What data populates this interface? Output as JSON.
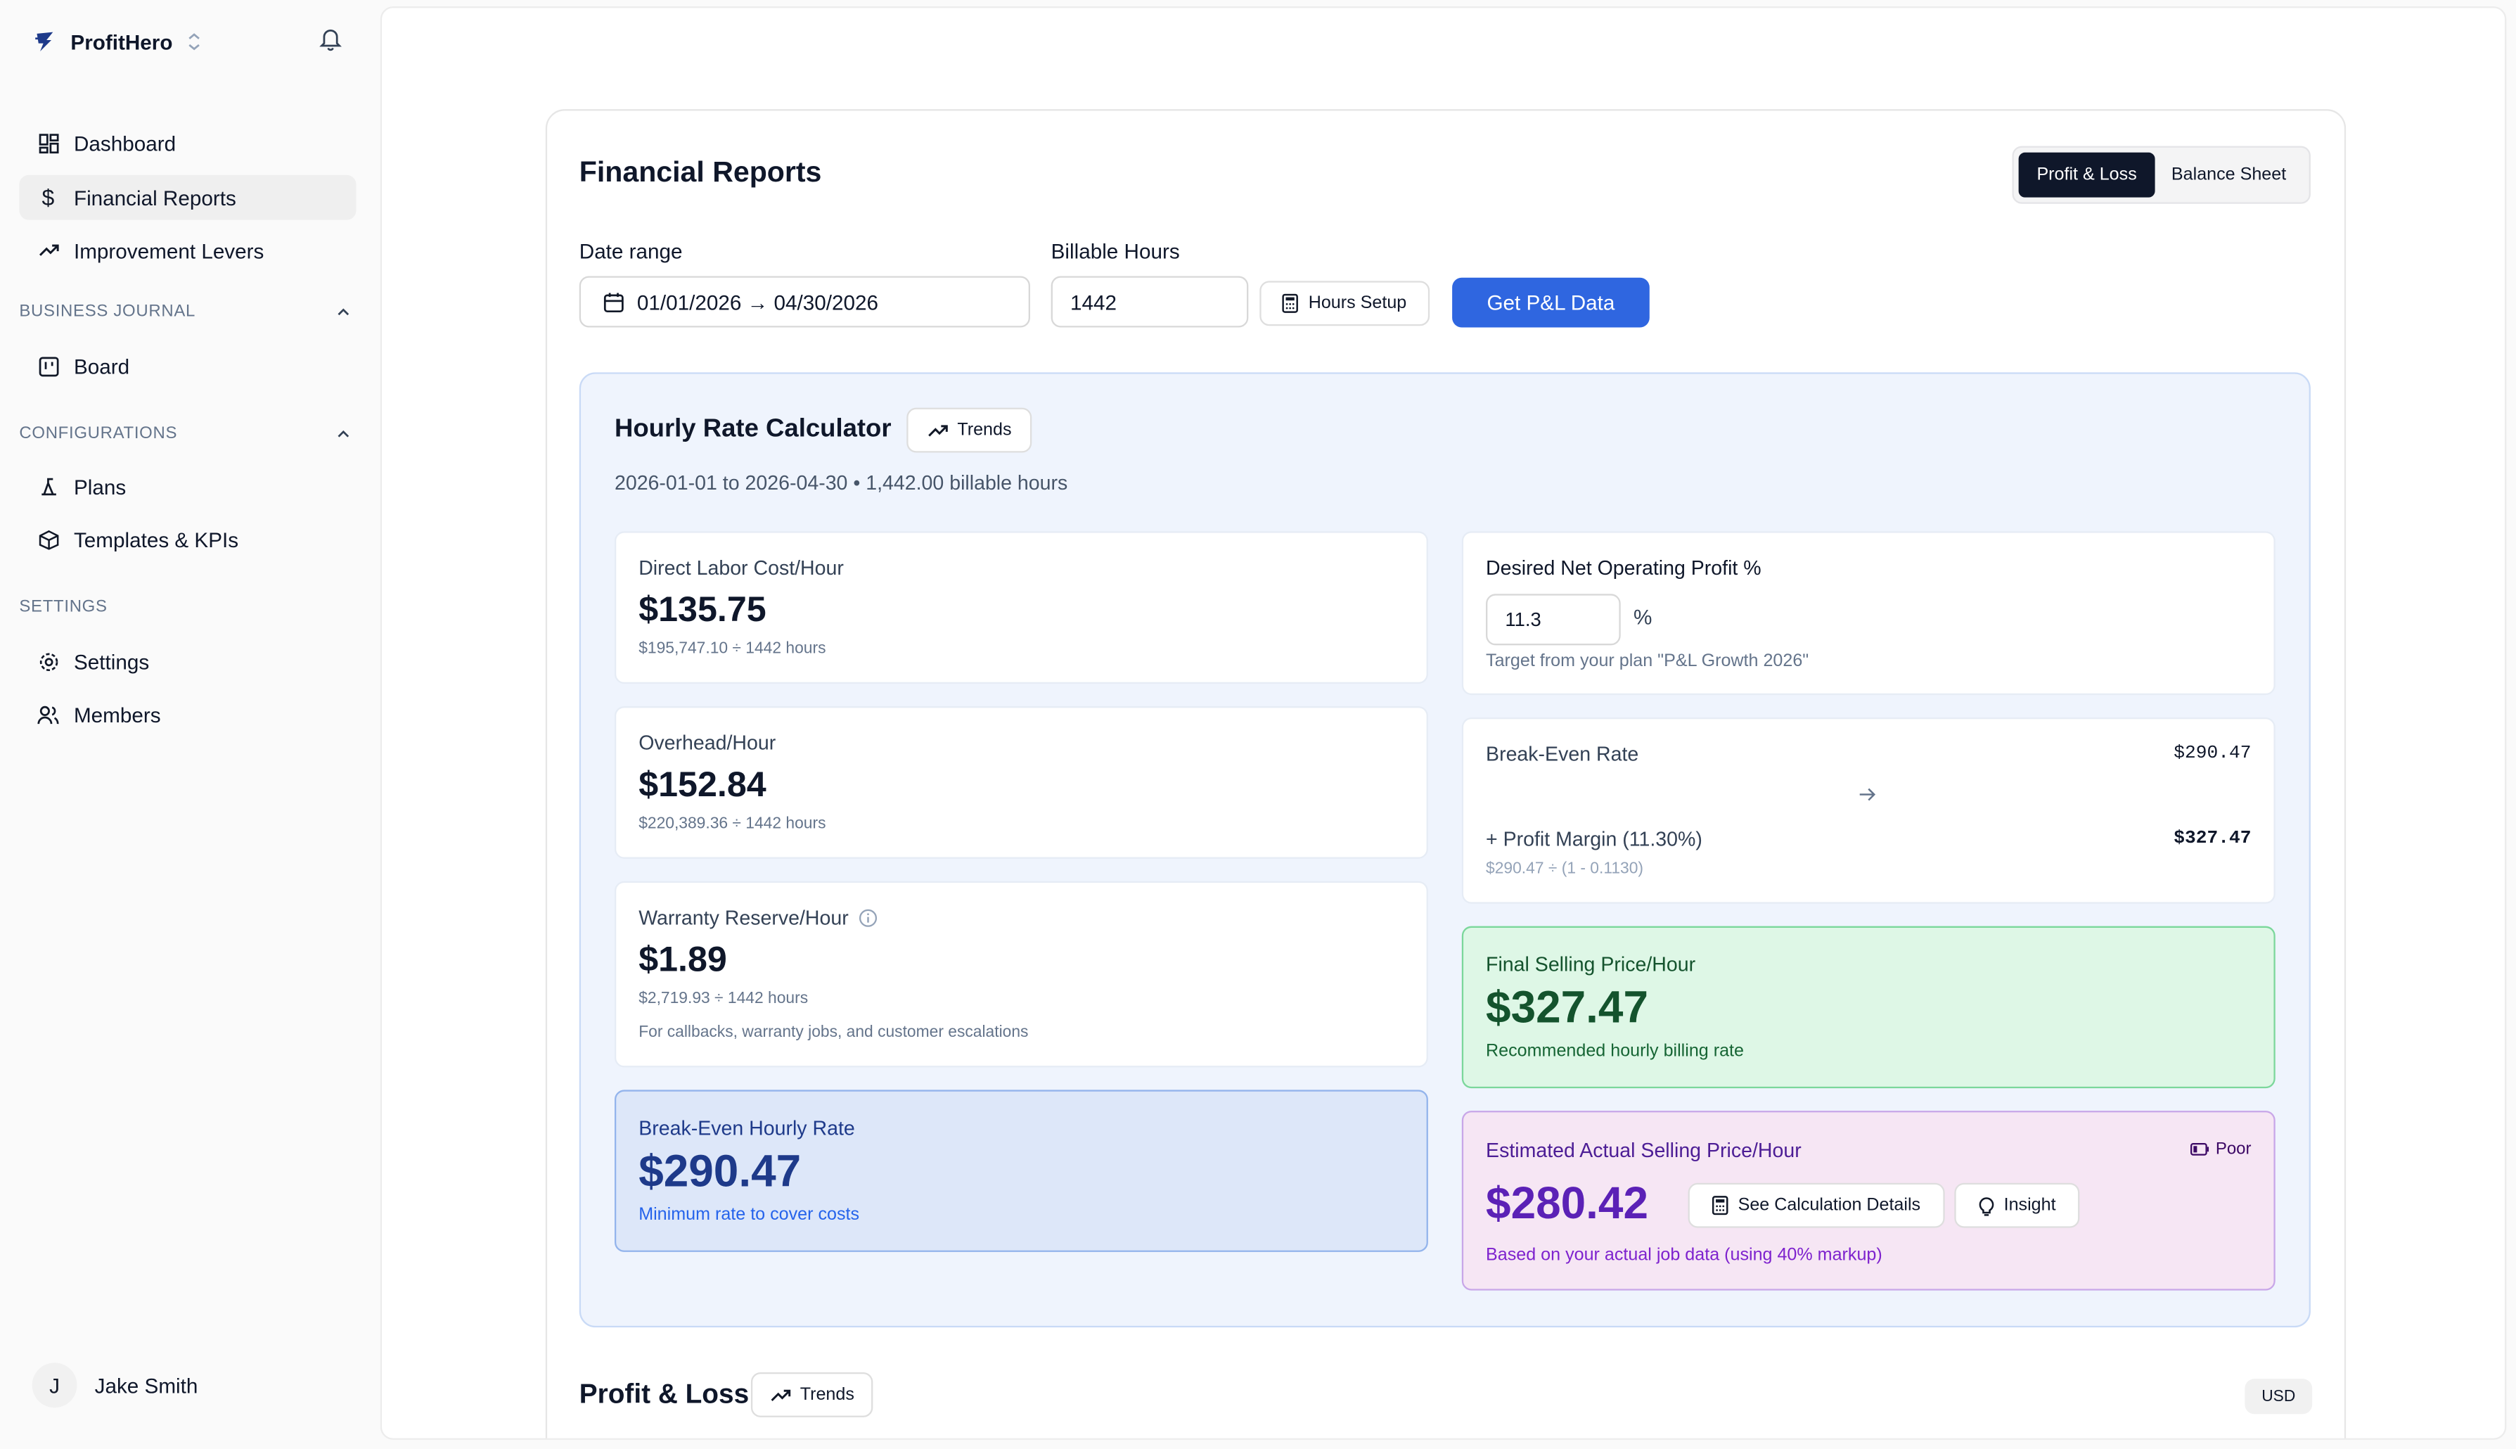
{
  "sidebar": {
    "brand": "ProfitHero",
    "nav": [
      {
        "label": "Dashboard",
        "icon": "dashboard-grid-icon"
      },
      {
        "label": "Financial Reports",
        "icon": "dollar-icon",
        "active": true
      },
      {
        "label": "Improvement Levers",
        "icon": "trending-up-icon"
      }
    ],
    "sections": [
      {
        "title": "BUSINESS JOURNAL",
        "items": [
          {
            "label": "Board",
            "icon": "kanban-board-icon"
          }
        ]
      },
      {
        "title": "CONFIGURATIONS",
        "items": [
          {
            "label": "Plans",
            "icon": "plans-icon"
          },
          {
            "label": "Templates & KPIs",
            "icon": "package-icon"
          }
        ]
      },
      {
        "title": "SETTINGS",
        "items": [
          {
            "label": "Settings",
            "icon": "gear-icon"
          },
          {
            "label": "Members",
            "icon": "users-icon"
          }
        ]
      }
    ],
    "user": {
      "initial": "J",
      "name": "Jake Smith"
    }
  },
  "header": {
    "title": "Financial Reports",
    "tabs": {
      "profit_loss": "Profit & Loss",
      "balance_sheet": "Balance Sheet"
    },
    "active_tab": "Profit & Loss"
  },
  "filters": {
    "date_range_label": "Date range",
    "date_range_value": "01/01/2026 → 04/30/2026",
    "billable_hours_label": "Billable Hours",
    "billable_hours_value": "1442",
    "hours_setup": "Hours Setup",
    "get_data": "Get P&L Data"
  },
  "calculator": {
    "title": "Hourly Rate Calculator",
    "trends": "Trends",
    "subtitle": "2026-01-01 to 2026-04-30  • 1,442.00 billable hours",
    "direct_labor": {
      "label": "Direct Labor Cost/Hour",
      "value": "$135.75",
      "formula": "$195,747.10 ÷ 1442 hours"
    },
    "overhead": {
      "label": "Overhead/Hour",
      "value": "$152.84",
      "formula": "$220,389.36 ÷ 1442 hours"
    },
    "warranty": {
      "label": "Warranty Reserve/Hour",
      "value": "$1.89",
      "formula": "$2,719.93 ÷ 1442 hours",
      "note": "For callbacks, warranty jobs, and customer escalations"
    },
    "break_even": {
      "label": "Break-Even Hourly Rate",
      "value": "$290.47",
      "note": "Minimum rate to cover costs"
    },
    "desired_profit": {
      "label": "Desired Net Operating Profit %",
      "value": "11.3",
      "unit": "%",
      "note": "Target from your plan \"P&L Growth 2026\""
    },
    "breakdown": {
      "break_even_label": "Break-Even Rate",
      "break_even_value": "$290.47",
      "margin_label": "+ Profit Margin (11.30%)",
      "margin_value": "$327.47",
      "formula": "$290.47 ÷ (1 - 0.1130)"
    },
    "final_price": {
      "label": "Final Selling Price/Hour",
      "value": "$327.47",
      "note": "Recommended hourly billing rate"
    },
    "estimated": {
      "label": "Estimated Actual Selling Price/Hour",
      "value": "$280.42",
      "status": "Poor",
      "details_btn": "See Calculation Details",
      "insight_btn": "Insight",
      "note": "Based on your actual job data (using 40% markup)"
    }
  },
  "pl": {
    "title": "Profit & Loss",
    "trends": "Trends",
    "currency": "USD"
  },
  "colors": {
    "primary": "#2f66e0",
    "dark": "#0f172a",
    "blue_value": "#1e3a8a",
    "green_value": "#14532d",
    "purple_value": "#5b21b6"
  }
}
